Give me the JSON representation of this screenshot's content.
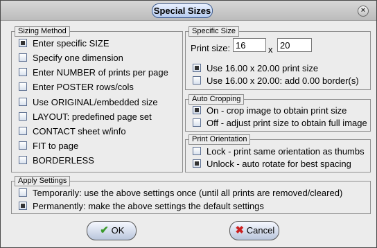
{
  "window": {
    "title": "Special Sizes",
    "close_glyph": "×"
  },
  "sizing_method": {
    "title": "Sizing Method",
    "items": [
      {
        "label": "Enter specific SIZE",
        "checked": true
      },
      {
        "label": "Specify one dimension",
        "checked": false
      },
      {
        "label": "Enter NUMBER of prints per page",
        "checked": false
      },
      {
        "label": "Enter POSTER rows/cols",
        "checked": false
      },
      {
        "label": "Use ORIGINAL/embedded size",
        "checked": false
      },
      {
        "label": "LAYOUT: predefined page set",
        "checked": false
      },
      {
        "label": "CONTACT sheet w/info",
        "checked": false
      },
      {
        "label": "FIT to page",
        "checked": false
      },
      {
        "label": "BORDERLESS",
        "checked": false
      }
    ]
  },
  "specific_size": {
    "title": "Specific Size",
    "print_size_label": "Print size:",
    "width_value": "16",
    "x_label": "x",
    "height_value": "20",
    "options": [
      {
        "label": "Use 16.00 x 20.00 print size",
        "checked": true
      },
      {
        "label": "Use 16.00 x 20.00: add 0.00 border(s)",
        "checked": false
      }
    ]
  },
  "auto_cropping": {
    "title": "Auto Cropping",
    "options": [
      {
        "label": "On - crop image to obtain print size",
        "checked": true
      },
      {
        "label": "Off - adjust print size to obtain full image",
        "checked": false
      }
    ]
  },
  "print_orientation": {
    "title": "Print Orientation",
    "options": [
      {
        "label": "Lock - print same orientation as thumbs",
        "checked": false
      },
      {
        "label": "Unlock - auto rotate for best spacing",
        "checked": true
      }
    ]
  },
  "apply_settings": {
    "title": "Apply Settings",
    "options": [
      {
        "label": "Temporarily: use the above settings once (until all prints are removed/cleared)",
        "checked": false
      },
      {
        "label": "Permanently: make the above settings the default settings",
        "checked": true
      }
    ]
  },
  "buttons": {
    "ok_label": "OK",
    "ok_icon": "✔",
    "cancel_label": "Cancel",
    "cancel_icon": "✖"
  },
  "colors": {
    "ok_icon": "#3a9a2a",
    "cancel_icon": "#cc2020"
  }
}
